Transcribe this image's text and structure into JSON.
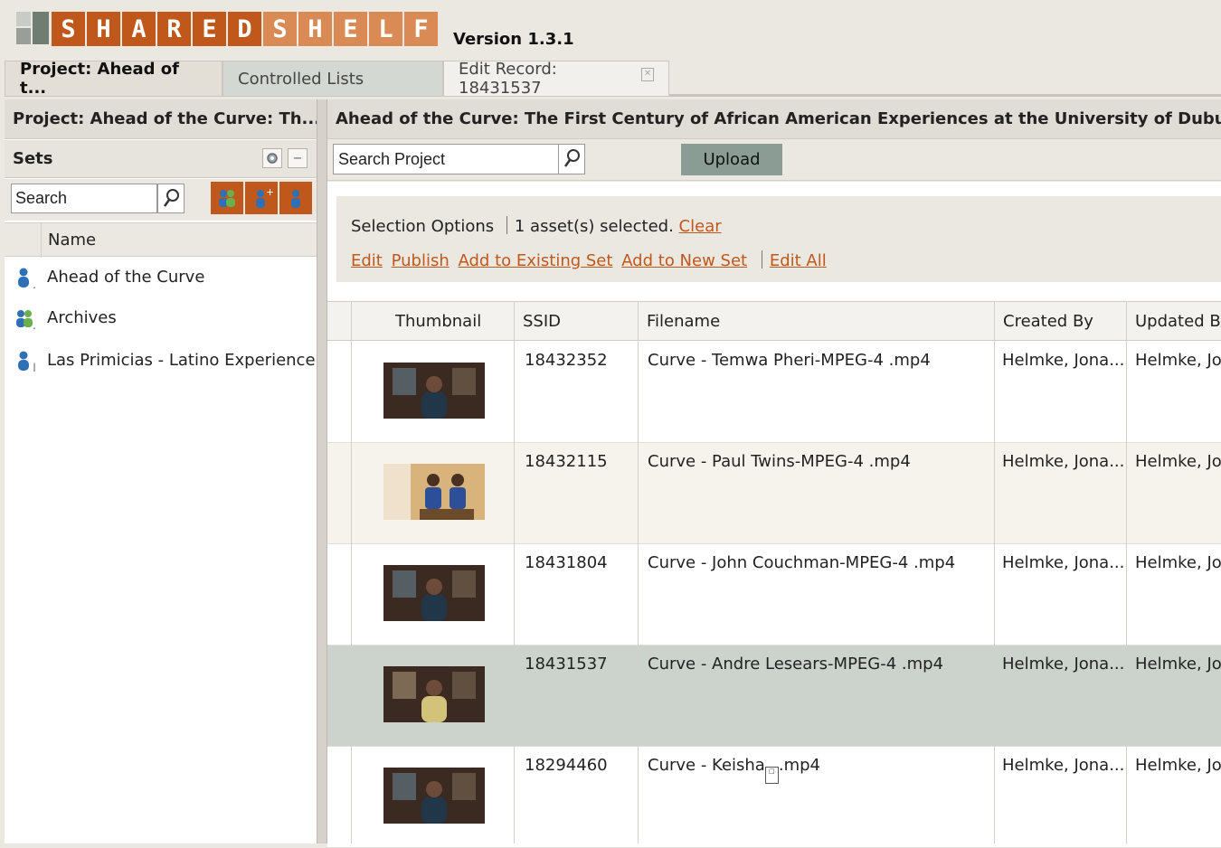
{
  "logo": {
    "letters": [
      "S",
      "H",
      "A",
      "R",
      "E",
      "D",
      "S",
      "H",
      "E",
      "L",
      "F"
    ],
    "letter_colors": [
      "#c0581b",
      "#c0581b",
      "#c0581b",
      "#c0581b",
      "#c0581b",
      "#c0581b",
      "#d98a55",
      "#d98a55",
      "#d98a55",
      "#d98a55",
      "#d98a55"
    ],
    "version": "Version 1.3.1"
  },
  "tabs": [
    {
      "label": "Project: Ahead of t..."
    },
    {
      "label": "Controlled Lists"
    },
    {
      "label": "Edit Record: 18431537"
    }
  ],
  "left_pane": {
    "title": "Project: Ahead of the Curve: Th...",
    "sets_title": "Sets",
    "search_placeholder": "Search",
    "name_header": "Name",
    "sets": [
      {
        "label": "Ahead of the Curve",
        "icon": "single-user-icon",
        "marker": ","
      },
      {
        "label": "Archives",
        "icon": "user-group-icon",
        "marker": ","
      },
      {
        "label": "Las Primicias - Latino Experience...",
        "icon": "single-user-icon",
        "marker": "|"
      }
    ]
  },
  "right_pane": {
    "title": "Ahead of the Curve: The First Century of African American Experiences at the University of Dubuque",
    "search_value": "Search Project",
    "upload_label": "Upload",
    "selection": {
      "prefix": "Selection Options",
      "status": "1 asset(s) selected.",
      "clear": "Clear",
      "actions": [
        "Edit",
        "Publish",
        "Add to Existing Set",
        "Add to New Set"
      ],
      "edit_all": "Edit All"
    },
    "columns": [
      "Thumbnail",
      "SSID",
      "Filename",
      "Created By",
      "Updated By"
    ],
    "rows": [
      {
        "ssid": "18432352",
        "filename": "Curve - Temwa Pheri-MPEG-4 .mp4",
        "created_by": "Helmke, Jona...",
        "updated_by": "Helmke, Jo",
        "selected": false,
        "thumb": "interview-video-thumbnail"
      },
      {
        "ssid": "18432115",
        "filename": "Curve - Paul Twins-MPEG-4 .mp4",
        "created_by": "Helmke, Jona...",
        "updated_by": "Helmke, Jo",
        "selected": false,
        "thumb": "twins-video-thumbnail"
      },
      {
        "ssid": "18431804",
        "filename": "Curve - John Couchman-MPEG-4 .mp4",
        "created_by": "Helmke, Jona...",
        "updated_by": "Helmke, Jo",
        "selected": false,
        "thumb": "interview-video-thumbnail"
      },
      {
        "ssid": "18431537",
        "filename": "Curve - Andre Lesears-MPEG-4 .mp4",
        "created_by": "Helmke, Jona...",
        "updated_by": "Helmke, Jo",
        "selected": true,
        "thumb": "interview-video-thumbnail"
      },
      {
        "ssid": "18294460",
        "filename": "Curve - Keisha",
        "filename_suffix": ".mp4",
        "created_by": "Helmke, Jona...",
        "updated_by": "Helmke, Jo",
        "selected": false,
        "thumb": "interview-video-thumbnail"
      }
    ]
  },
  "colors": {
    "accent": "#c0581b",
    "selected_row": "#ccd3cd",
    "alt_row": "#f6f3ec",
    "upload_button": "#8a9c93"
  }
}
